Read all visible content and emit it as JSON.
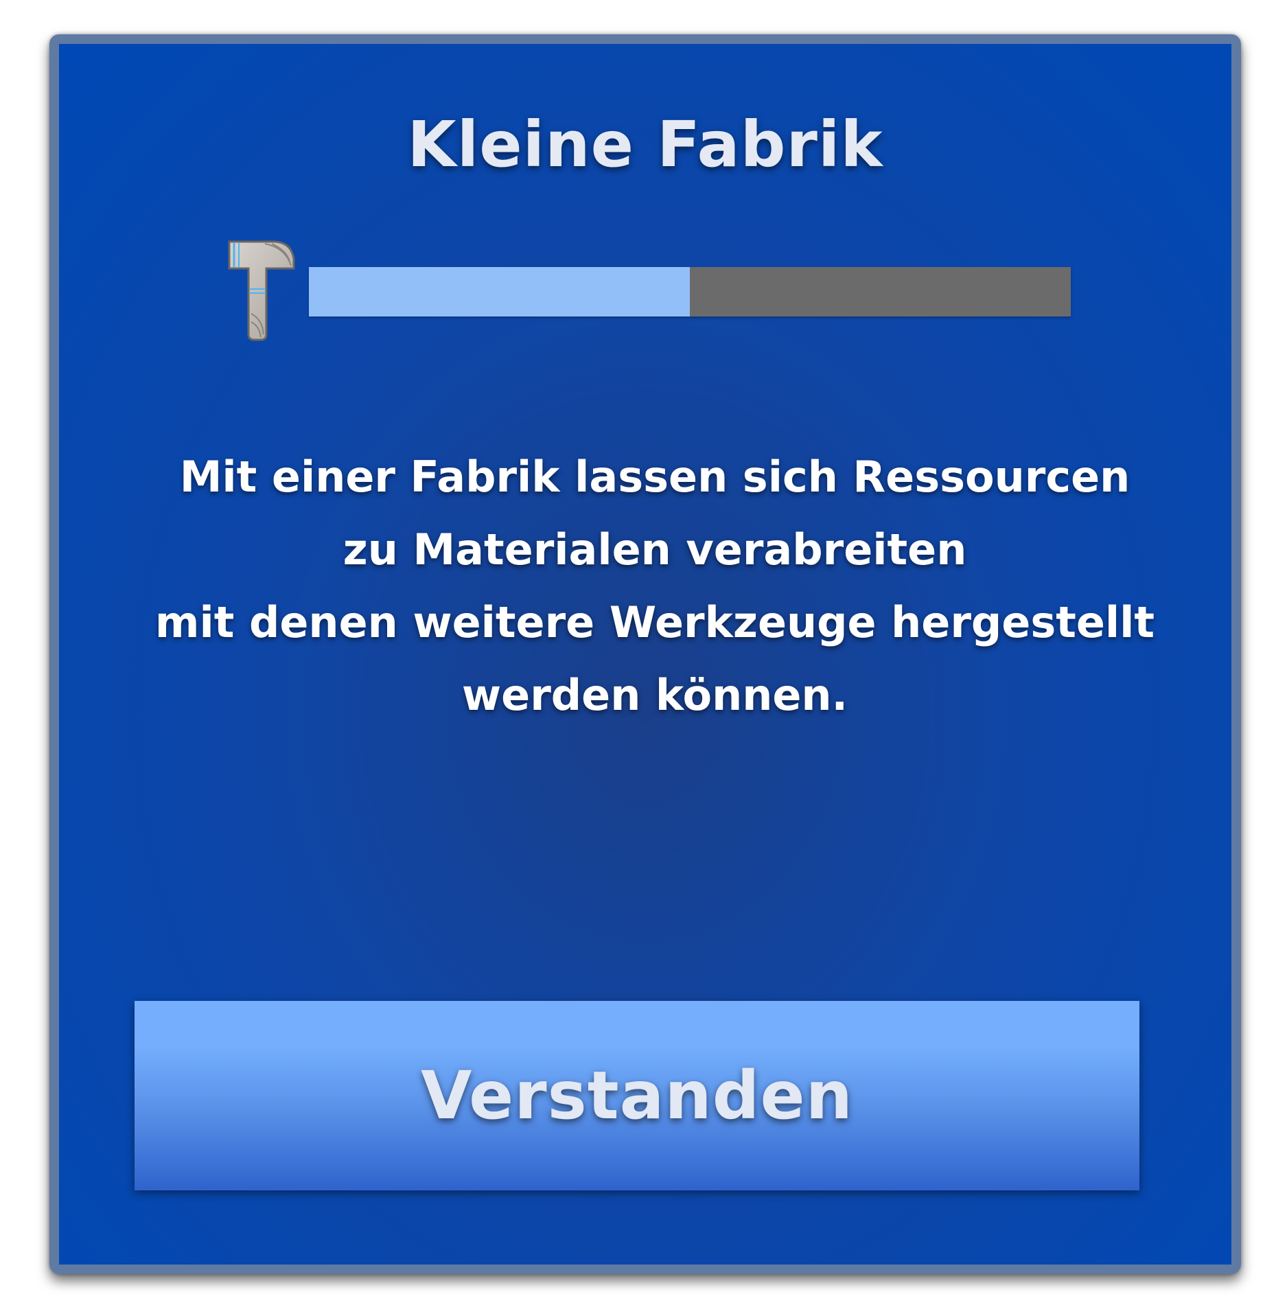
{
  "dialog": {
    "title": "Kleine Fabrik",
    "progress": {
      "icon": "hammer-icon",
      "value_percent": 50
    },
    "message_lines": [
      "Mit einer Fabrik lassen sich Ressourcen",
      "zu Materialen verabreiten",
      "mit denen weitere Werkzeuge hergestellt",
      "werden können."
    ],
    "confirm_label": "Verstanden"
  },
  "colors": {
    "panel_bg": "#0048b5",
    "panel_border": "#5f7aa3",
    "progress_fill": "#93bff9",
    "progress_track": "#6b6b6b",
    "button_top": "#74aefc",
    "button_bottom": "#2f63cc",
    "text": "#e4e9f4"
  }
}
